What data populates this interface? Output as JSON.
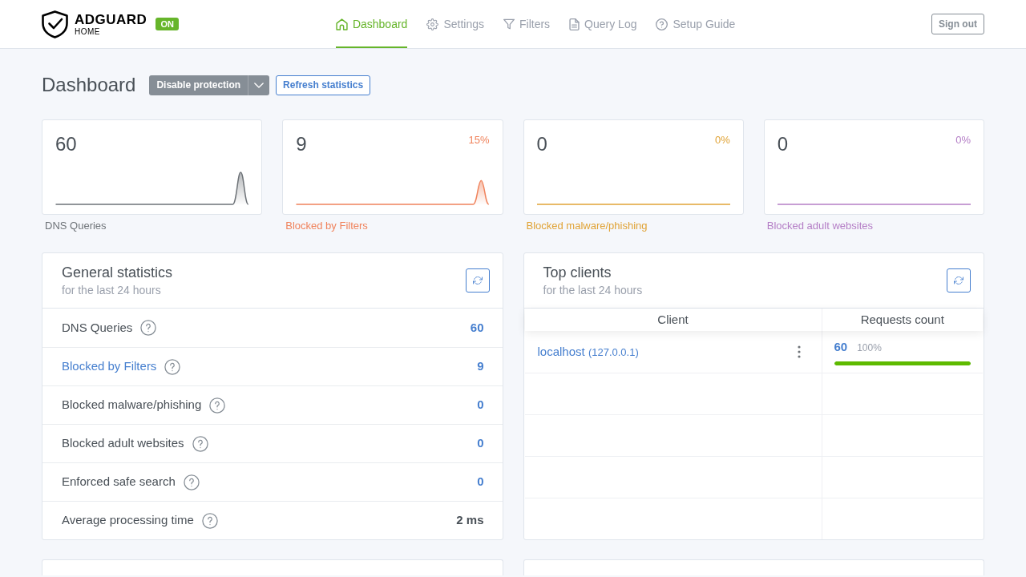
{
  "header": {
    "brand": {
      "name": "ADGUARD",
      "subtitle": "HOME"
    },
    "protection_badge": "ON",
    "nav": [
      {
        "label": "Dashboard",
        "selected": true
      },
      {
        "label": "Settings",
        "selected": false
      },
      {
        "label": "Filters",
        "selected": false
      },
      {
        "label": "Query Log",
        "selected": false
      },
      {
        "label": "Setup Guide",
        "selected": false
      }
    ],
    "sign_out": "Sign out"
  },
  "page_title": "Dashboard",
  "actions": {
    "disable_protection": "Disable protection",
    "refresh_statistics": "Refresh statistics"
  },
  "stat_cards": [
    {
      "value": "60",
      "label": "DNS Queries",
      "color": "#6e7378"
    },
    {
      "value": "9",
      "percent": "15%",
      "label": "Blocked by Filters",
      "color": "#f0835c"
    },
    {
      "value": "0",
      "percent": "0%",
      "label": "Blocked malware/phishing",
      "color": "#e0a336"
    },
    {
      "value": "0",
      "percent": "0%",
      "label": "Blocked adult websites",
      "color": "#b47ec6"
    }
  ],
  "general_statistics": {
    "title": "General statistics",
    "subtitle": "for the last 24 hours",
    "rows": [
      {
        "label": "DNS Queries",
        "link": false,
        "kind": "count",
        "value": "60"
      },
      {
        "label": "Blocked by Filters",
        "link": true,
        "kind": "count",
        "value": "9"
      },
      {
        "label": "Blocked malware/phishing",
        "link": false,
        "kind": "count",
        "value": "0"
      },
      {
        "label": "Blocked adult websites",
        "link": false,
        "kind": "count",
        "value": "0"
      },
      {
        "label": "Enforced safe search",
        "link": false,
        "kind": "count",
        "value": "0"
      },
      {
        "label": "Average processing time",
        "link": false,
        "kind": "time",
        "value": "2 ms"
      }
    ]
  },
  "top_clients": {
    "title": "Top clients",
    "subtitle": "for the last 24 hours",
    "columns": [
      "Client",
      "Requests count"
    ],
    "rows": [
      {
        "name": "localhost",
        "address": "(127.0.0.1)",
        "count": "60",
        "percent": "100%",
        "level": 1
      }
    ]
  }
}
